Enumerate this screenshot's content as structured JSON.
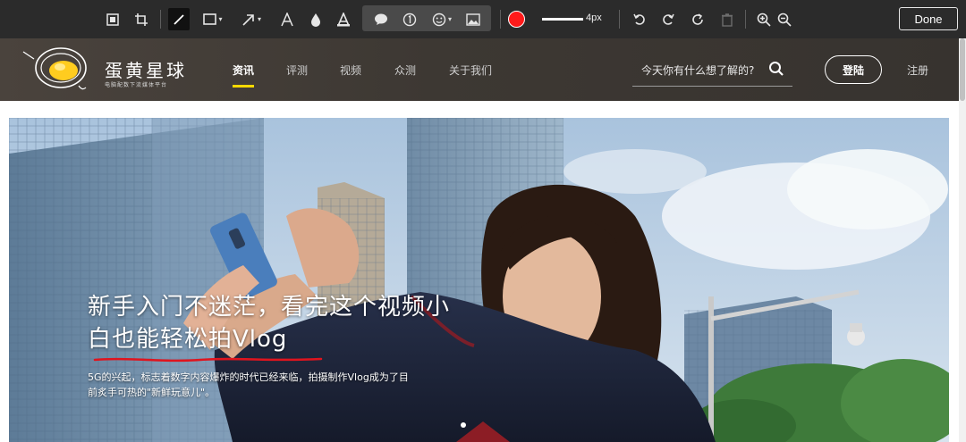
{
  "toolbar": {
    "tools": [
      "screenshot-icon",
      "crop-icon",
      "pen-icon",
      "rectangle-icon",
      "arrow-icon",
      "text-icon",
      "blur-icon",
      "highlight-icon",
      "speech-bubble-icon",
      "number-icon",
      "emoji-icon",
      "image-icon"
    ],
    "brush_color": "#ff1a1a",
    "stroke_width_label": "4px",
    "done_label": "Done"
  },
  "site": {
    "logo_text": "蛋黄星球",
    "logo_subtitle": "电脑配数下流媒体平台",
    "nav": [
      {
        "label": "资讯",
        "active": true
      },
      {
        "label": "评测",
        "active": false
      },
      {
        "label": "视频",
        "active": false
      },
      {
        "label": "众测",
        "active": false
      },
      {
        "label": "关于我们",
        "active": false
      }
    ],
    "search_placeholder": "今天你有什么想了解的?",
    "login_label": "登陆",
    "register_label": "注册",
    "accent_color": "#ffd900"
  },
  "hero": {
    "title_line1": "新手入门不迷茫，看完这个视频小",
    "title_line2": "白也能轻松拍Vlog",
    "description_line1": "5G的兴起，标志着数字内容爆炸的时代已经来临，拍摄制作Vlog成为了目",
    "description_line2": "前炙手可热的\"新鲜玩意儿\"。",
    "annotation_color": "#e0141e"
  }
}
